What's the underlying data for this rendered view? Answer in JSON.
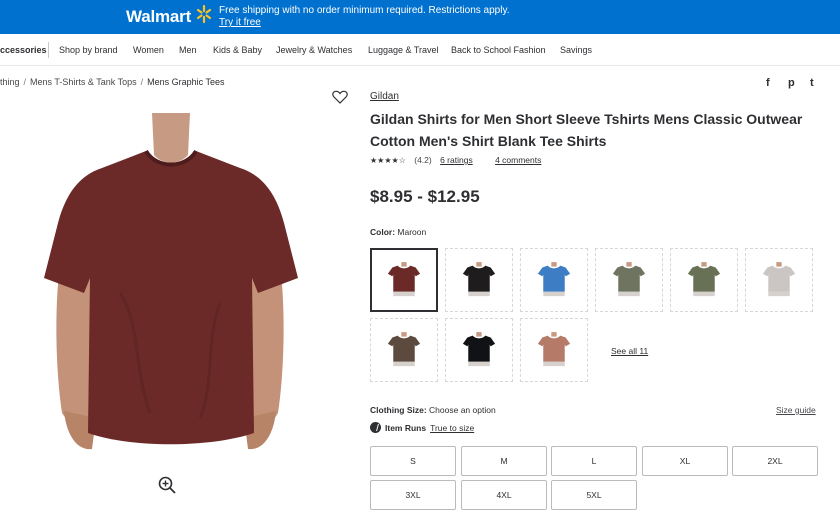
{
  "header": {
    "logo": "Walmart",
    "promo_text": "Free shipping with no order minimum required. Restrictions apply.",
    "promo_link": "Try it free",
    "brand_color": "#0071ce",
    "spark_color": "#ffc220"
  },
  "nav": {
    "items": [
      "ccessories",
      "Shop by brand",
      "Women",
      "Men",
      "Kids & Baby",
      "Jewelry & Watches",
      "Luggage & Travel",
      "Back to School Fashion",
      "Savings"
    ]
  },
  "breadcrumb": [
    "thing",
    "Mens T-Shirts & Tank Tops",
    "Mens Graphic Tees"
  ],
  "product": {
    "brand": "Gildan",
    "title": "Gildan Shirts for Men Short Sleeve Tshirts Mens Classic Outwear Cotton Men's Shirt Blank Tee Shirts",
    "stars": "★★★★☆",
    "rating_value": 4.2,
    "rating_text": "(4.2)",
    "ratings_link": "6 ratings",
    "comments_link": "4 comments",
    "price": "$8.95 - $12.95",
    "color_label": "Color:",
    "color_value": "Maroon",
    "shirt_color": "#6b2a28"
  },
  "social": {
    "icons": [
      "facebook-icon",
      "pinterest-icon",
      "twitter-icon"
    ],
    "labels": [
      "f",
      "p",
      "t"
    ]
  },
  "swatches": [
    {
      "name": "maroon",
      "color": "#6b2a28",
      "selected": true
    },
    {
      "name": "black",
      "color": "#1e1c1d"
    },
    {
      "name": "blue",
      "color": "#3d7dc4"
    },
    {
      "name": "military-green",
      "color": "#6e7460"
    },
    {
      "name": "olive",
      "color": "#687056"
    },
    {
      "name": "light-gray",
      "color": "#cbc6c3"
    },
    {
      "name": "brown",
      "color": "#5c4a3e"
    },
    {
      "name": "black-2",
      "color": "#111215"
    },
    {
      "name": "rose",
      "color": "#b57a68"
    }
  ],
  "see_all": "See all 11",
  "size": {
    "label": "Clothing Size:",
    "value": "Choose an option",
    "guide": "Size guide",
    "runs_label": "Item Runs",
    "runs_value": "True to size",
    "options": [
      "S",
      "M",
      "L",
      "XL",
      "2XL",
      "3XL",
      "4XL",
      "5XL"
    ]
  }
}
